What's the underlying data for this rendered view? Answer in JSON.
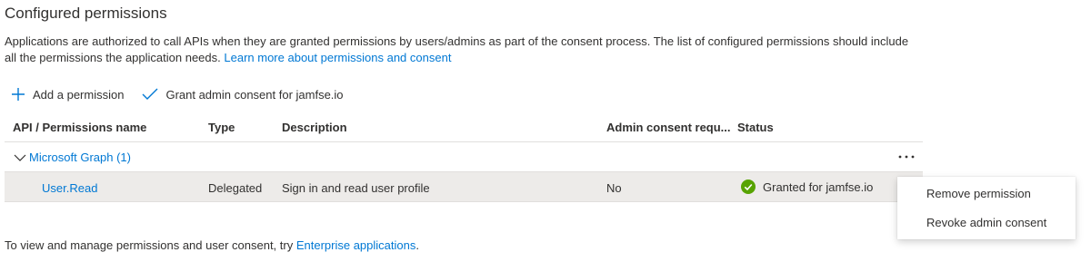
{
  "section": {
    "title": "Configured permissions",
    "description": "Applications are authorized to call APIs when they are granted permissions by users/admins as part of the consent process. The list of configured permissions should include all the permissions the application needs.",
    "learn_more_link": "Learn more about permissions and consent"
  },
  "toolbar": {
    "add_permission_label": "Add a permission",
    "grant_consent_label": "Grant admin consent for jamfse.io"
  },
  "table": {
    "headers": {
      "api": "API / Permissions name",
      "type": "Type",
      "description": "Description",
      "admin_consent": "Admin consent requ...",
      "status": "Status"
    },
    "group": {
      "label": "Microsoft Graph (1)"
    },
    "rows": [
      {
        "name": "User.Read",
        "type": "Delegated",
        "description": "Sign in and read user profile",
        "admin_consent": "No",
        "status": "Granted for jamfse.io"
      }
    ]
  },
  "context_menu": {
    "items": [
      "Remove permission",
      "Revoke admin consent"
    ]
  },
  "footer": {
    "text": "To view and manage permissions and user consent, try",
    "link": "Enterprise applications",
    "suffix": "."
  },
  "colors": {
    "accent": "#0078d4",
    "success": "#57a300",
    "selected_row": "#edebe9"
  }
}
